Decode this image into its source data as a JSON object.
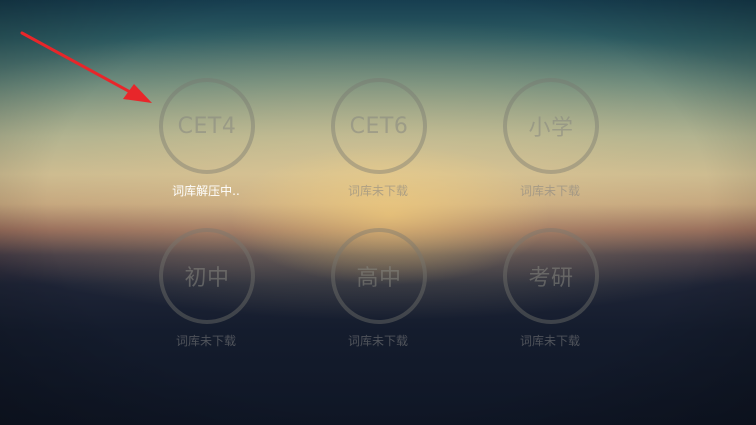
{
  "colors": {
    "arrow": "#e8262a",
    "ring": "#787870",
    "active_status": "#ffffff",
    "inactive_status": "#828282"
  },
  "tiles": [
    {
      "label": "CET4",
      "status": "词库解压中..",
      "active": true
    },
    {
      "label": "CET6",
      "status": "词库未下载",
      "active": false
    },
    {
      "label": "小学",
      "status": "词库未下载",
      "active": false
    },
    {
      "label": "初中",
      "status": "词库未下载",
      "active": false
    },
    {
      "label": "高中",
      "status": "词库未下载",
      "active": false
    },
    {
      "label": "考研",
      "status": "词库未下载",
      "active": false
    }
  ],
  "annotation": {
    "icon": "red-arrow-pointer"
  }
}
